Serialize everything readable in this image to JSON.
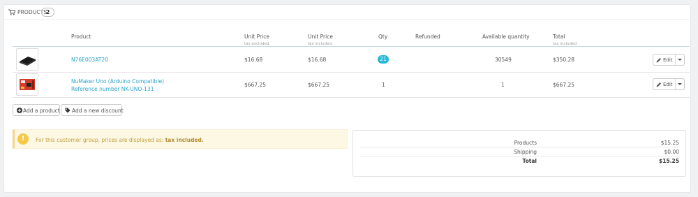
{
  "panel": {
    "title": "PRODUCTS",
    "count": "2",
    "icon": "cart-icon"
  },
  "table": {
    "headers": {
      "product": "Product",
      "unit_price_excl": "Unit Price",
      "unit_price_excl_sub": "tax excluded.",
      "unit_price_incl": "Unit Price",
      "unit_price_incl_sub": "tax included.",
      "qty": "Qty",
      "refunded": "Refunded",
      "available": "Available quantity",
      "total": "Total",
      "total_sub": "tax included."
    },
    "rows": [
      {
        "name": "N76E003AT20",
        "name_line2": "",
        "unit_excl": "$16.68",
        "unit_incl": "$16.68",
        "qty": "21",
        "refunded": "",
        "available": "30549",
        "total": "$350.28",
        "edit": "Edit"
      },
      {
        "name": "NuMaker Uno (Arduino Compatible)",
        "name_line2": "Reference number NK-UNO-131",
        "unit_excl": "$667.25",
        "unit_incl": "$667.25",
        "qty": "1",
        "refunded": "",
        "available": "1",
        "total": "$667.25",
        "edit": "Edit"
      }
    ]
  },
  "actions": {
    "add_product": "Add a product",
    "add_discount": "Add a new discount"
  },
  "alert": {
    "text": "For this customer group, prices are displayed as: ",
    "strong": "tax included."
  },
  "totals": {
    "products_label": "Products",
    "products_value": "$15.25",
    "shipping_label": "Shipping",
    "shipping_value": "$0.00",
    "total_label": "Total",
    "total_value": "$15.25"
  },
  "colors": {
    "accent": "#25b9d7",
    "link": "#2ca4c9",
    "warning_bg": "#fcf8e3"
  }
}
